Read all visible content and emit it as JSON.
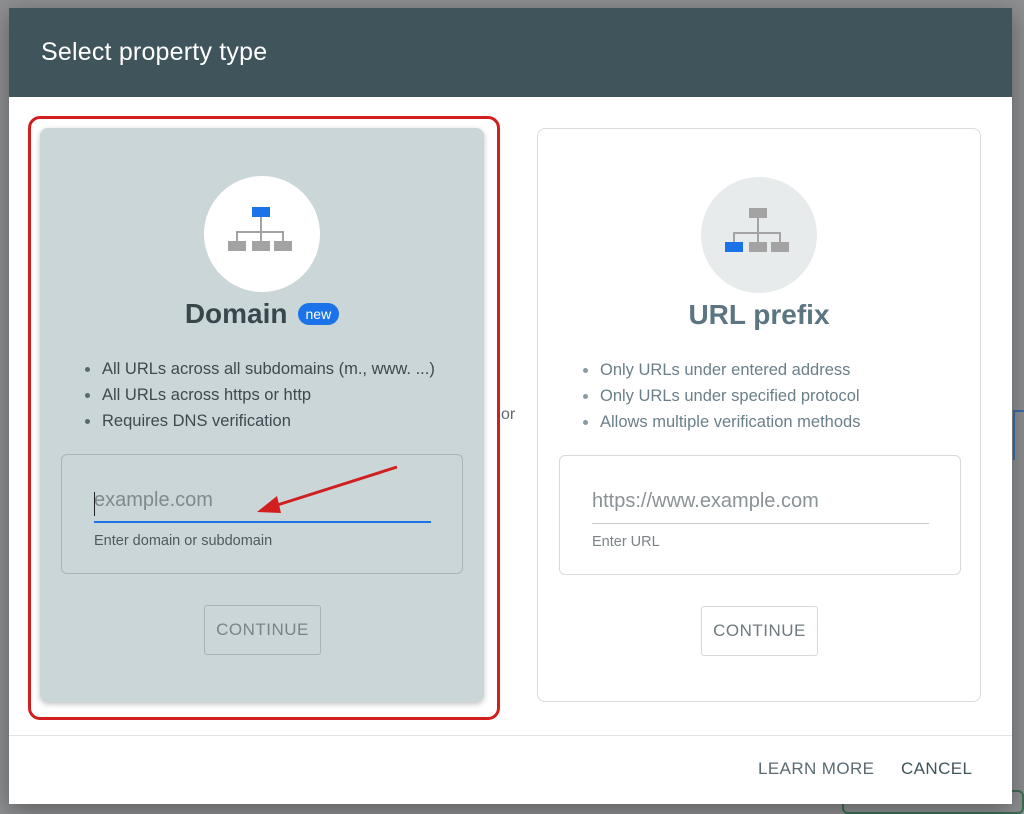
{
  "dialog": {
    "title": "Select property type",
    "or_label": "or"
  },
  "domain_card": {
    "title": "Domain",
    "badge": "new",
    "features": [
      "All URLs across all subdomains (m., www. ...)",
      "All URLs across https or http",
      "Requires DNS verification"
    ],
    "input": {
      "placeholder": "example.com",
      "value": "",
      "helper": "Enter domain or subdomain"
    },
    "continue_label": "CONTINUE",
    "icon": "sitemap-icon"
  },
  "url_prefix_card": {
    "title": "URL prefix",
    "features": [
      "Only URLs under entered address",
      "Only URLs under specified protocol",
      "Allows multiple verification methods"
    ],
    "input": {
      "placeholder": "https://www.example.com",
      "value": "",
      "helper": "Enter URL"
    },
    "continue_label": "CONTINUE",
    "icon": "sitemap-icon"
  },
  "footer": {
    "learn_more_label": "LEARN MORE",
    "cancel_label": "CANCEL"
  },
  "colors": {
    "header_bg": "#3f545b",
    "accent": "#1a73e8",
    "highlight": "#d11f1f",
    "selected_card_bg": "#cbd6d8"
  }
}
